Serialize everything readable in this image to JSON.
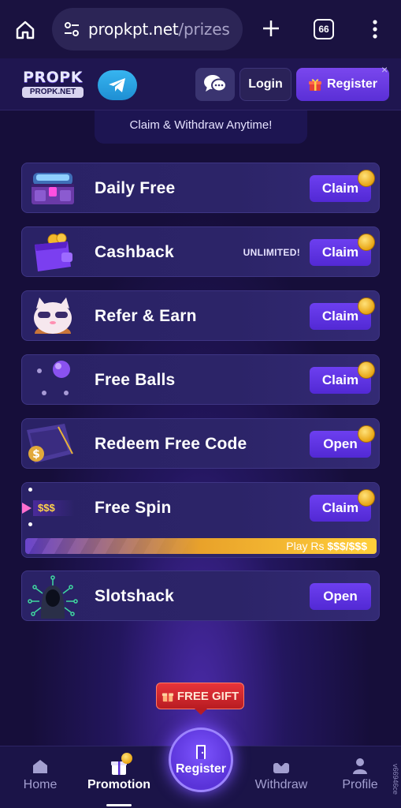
{
  "browser": {
    "url_domain": "propkpt.net",
    "url_path": "/prizes",
    "tab_count": "66"
  },
  "header": {
    "logo_top": "PROPK",
    "logo_bottom": "PROPK.NET",
    "login_label": "Login",
    "register_label": "Register",
    "close_symbol": "×"
  },
  "banner": {
    "text": "Claim & Withdraw Anytime!"
  },
  "cards": [
    {
      "title": "Daily Free",
      "button": "Claim",
      "badge": ""
    },
    {
      "title": "Cashback",
      "button": "Claim",
      "badge": "UNLIMITED!"
    },
    {
      "title": "Refer & Earn",
      "button": "Claim",
      "badge": ""
    },
    {
      "title": "Free Balls",
      "button": "Claim",
      "badge": ""
    },
    {
      "title": "Redeem Free Code",
      "button": "Open",
      "badge": ""
    },
    {
      "title": "Free Spin",
      "button": "Claim",
      "badge": "",
      "progress_label": "Play Rs",
      "progress_amount": "$$$/$$$",
      "icon_text": "$$$"
    },
    {
      "title": "Slotshack",
      "button": "Open",
      "badge": ""
    }
  ],
  "free_gift_label": "FREE GIFT",
  "bottom_nav": {
    "home": "Home",
    "promotion": "Promotion",
    "register": "Register",
    "withdraw": "Withdraw",
    "profile": "Profile"
  },
  "side_id": "v66946ce",
  "colors": {
    "background": "#160e3a",
    "accent_purple": "#5a2fd6",
    "coin_gold": "#e8a514",
    "gift_red": "#d1262c"
  }
}
